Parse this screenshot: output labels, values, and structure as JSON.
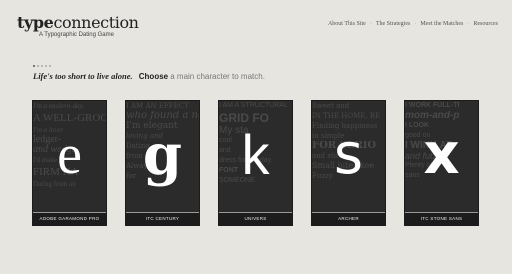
{
  "header": {
    "logo_bold": "type",
    "logo_light": "connection",
    "tagline": "A Typographic Dating Game"
  },
  "nav": {
    "items": [
      "About This Site",
      "The Strategies",
      "Meet the Matches",
      "Resources"
    ]
  },
  "intro": {
    "lead": "Life's too short to live alone.",
    "choose": "Choose",
    "rest": "a main character to match."
  },
  "progress": {
    "total_steps": 5,
    "current_step": 1
  },
  "cards": [
    {
      "letter": "e",
      "name": "ADOBE GARAMOND PRO",
      "bg_lines": [
        "I'm a modern-day,",
        "A WELL-GROO",
        "I'm a lover",
        "ledger-",
        "and wedge-",
        "I'd make",
        "FIRM HA",
        "Dating from an"
      ]
    },
    {
      "letter": "g",
      "name": "ITC CENTURY",
      "bg_lines": [
        "I AM AN EFFECT",
        "who found a ne",
        "I'm elegant",
        "loving and",
        "Dating",
        "from",
        "Always",
        "for"
      ]
    },
    {
      "letter": "k",
      "name": "UNIVERS",
      "bg_lines": [
        "I AM A STRUCTURAL",
        "GRID FO",
        "My sta",
        "cool",
        "and",
        "dress for the day",
        "FONT",
        "SOMEONE"
      ]
    },
    {
      "letter": "s",
      "name": "ARCHER",
      "bg_lines": [
        "Sweet and",
        "IN THE HOME, RE",
        "Finding happiness",
        "in simple",
        "FOR SERIO",
        "and stick",
        "Small bites kee",
        "Fuzzy"
      ]
    },
    {
      "letter": "x",
      "name": "ITC STONE SANS",
      "bg_lines": [
        "I WORK FULL-TI",
        "mom-and-p",
        "I LOOK",
        "good on",
        "I WINK AT",
        "and futz wi",
        "Plenty of",
        "sans"
      ]
    }
  ]
}
